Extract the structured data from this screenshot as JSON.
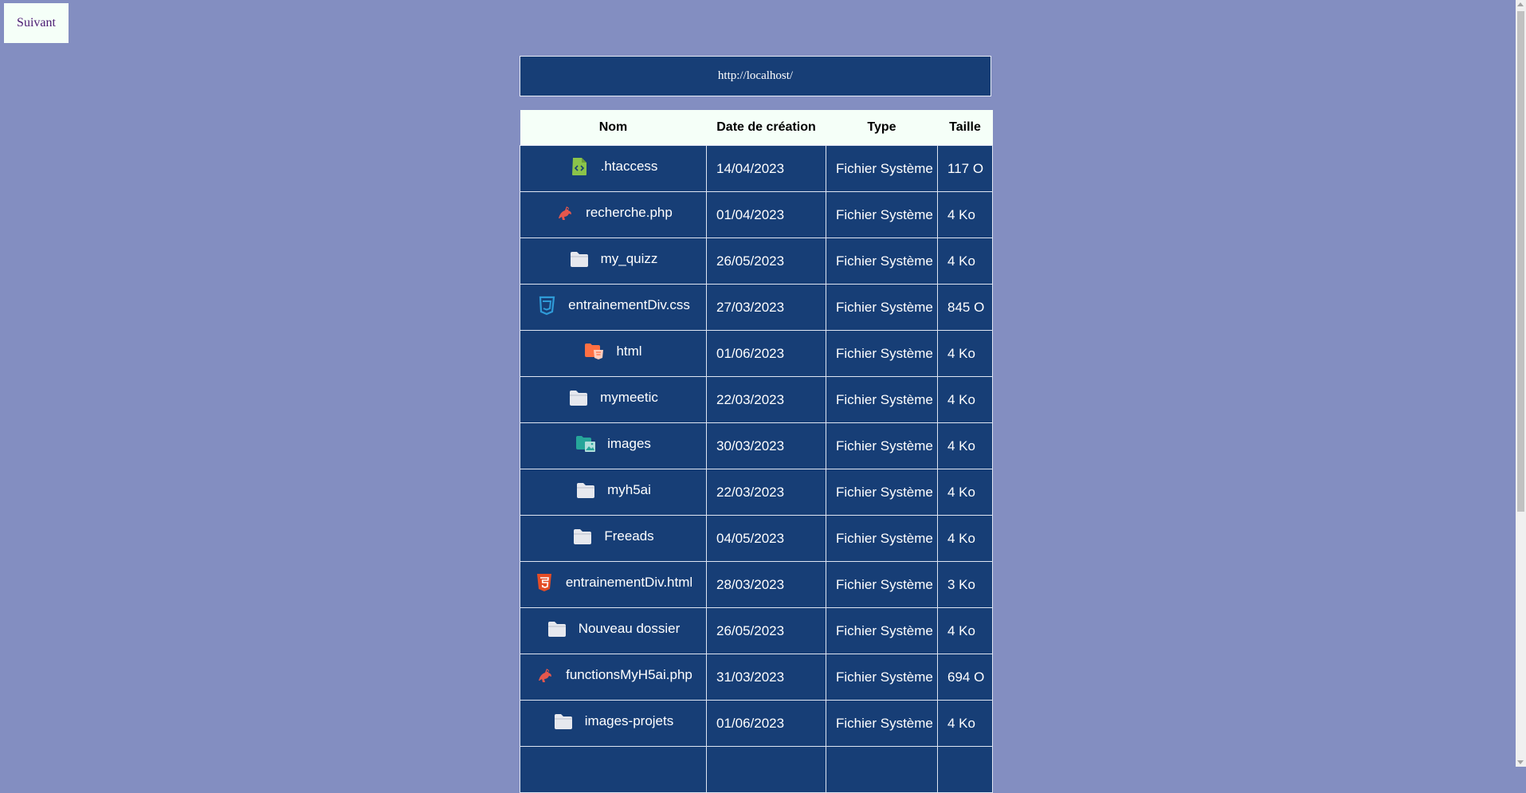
{
  "nav": {
    "next_label": "Suivant"
  },
  "location": {
    "url": "http://localhost/"
  },
  "table": {
    "headers": {
      "name": "Nom",
      "date": "Date de création",
      "type": "Type",
      "size": "Taille"
    },
    "rows": [
      {
        "name": ".htaccess",
        "date": "14/04/2023",
        "type": "Fichier Système",
        "size": "117 O",
        "icon": "code-file-icon"
      },
      {
        "name": "recherche.php",
        "date": "01/04/2023",
        "type": "Fichier Système",
        "size": "4 Ko",
        "icon": "php-icon"
      },
      {
        "name": "my_quizz",
        "date": "26/05/2023",
        "type": "Fichier Système",
        "size": "4 Ko",
        "icon": "folder-icon"
      },
      {
        "name": "entrainementDiv.css",
        "date": "27/03/2023",
        "type": "Fichier Système",
        "size": "845 O",
        "icon": "css-icon"
      },
      {
        "name": "html",
        "date": "01/06/2023",
        "type": "Fichier Système",
        "size": "4 Ko",
        "icon": "html-folder-icon"
      },
      {
        "name": "mymeetic",
        "date": "22/03/2023",
        "type": "Fichier Système",
        "size": "4 Ko",
        "icon": "folder-icon"
      },
      {
        "name": "images",
        "date": "30/03/2023",
        "type": "Fichier Système",
        "size": "4 Ko",
        "icon": "images-folder-icon"
      },
      {
        "name": "myh5ai",
        "date": "22/03/2023",
        "type": "Fichier Système",
        "size": "4 Ko",
        "icon": "folder-icon"
      },
      {
        "name": "Freeads",
        "date": "04/05/2023",
        "type": "Fichier Système",
        "size": "4 Ko",
        "icon": "folder-icon"
      },
      {
        "name": "entrainementDiv.html",
        "date": "28/03/2023",
        "type": "Fichier Système",
        "size": "3 Ko",
        "icon": "html5-icon"
      },
      {
        "name": "Nouveau dossier",
        "date": "26/05/2023",
        "type": "Fichier Système",
        "size": "4 Ko",
        "icon": "folder-icon"
      },
      {
        "name": "functionsMyH5ai.php",
        "date": "31/03/2023",
        "type": "Fichier Système",
        "size": "694 O",
        "icon": "php-icon"
      },
      {
        "name": "images-projets",
        "date": "01/06/2023",
        "type": "Fichier Système",
        "size": "4 Ko",
        "icon": "folder-icon"
      },
      {
        "name": "",
        "date": "",
        "type": "",
        "size": "",
        "icon": ""
      }
    ]
  },
  "colors": {
    "page_bg": "#838ec1",
    "row_bg": "#173e76",
    "header_bg": "#f5fff8",
    "folder": "#e6e8ee",
    "php": "#e5574d",
    "css": "#2f9bd8",
    "html5": "#e44d26",
    "code_file": "#8bc34a",
    "html_folder": "#ff7043",
    "images_folder": "#26a69a"
  }
}
